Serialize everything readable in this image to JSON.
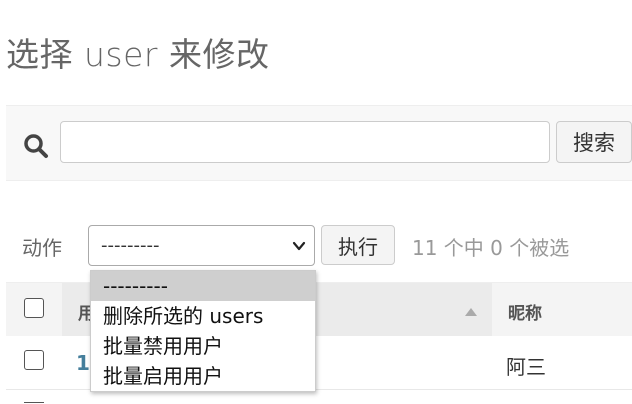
{
  "page": {
    "title": "选择 user 来修改"
  },
  "search": {
    "value": "",
    "placeholder": "",
    "button_label": "搜索"
  },
  "actions": {
    "label": "动作",
    "selected": "---------",
    "go_label": "执行",
    "counter": "11 个中 0 个被选",
    "options": [
      "---------",
      "删除所选的 users",
      "批量禁用用户",
      "批量启用用户"
    ]
  },
  "table": {
    "columns": [
      {
        "label": "用",
        "sorted": "ascending"
      },
      {
        "label": "昵称"
      }
    ],
    "rows": [
      {
        "id": "1",
        "nickname": "阿三"
      }
    ]
  },
  "icons": {
    "search": "search-icon",
    "select": "chevron-down-icon",
    "sort": "sort-asc-icon"
  },
  "colors": {
    "link": "#447e9b",
    "header_bg": "#f4f4f4",
    "sorted_header_bg": "#ebebeb",
    "option_highlight": "#cfcfcf"
  }
}
